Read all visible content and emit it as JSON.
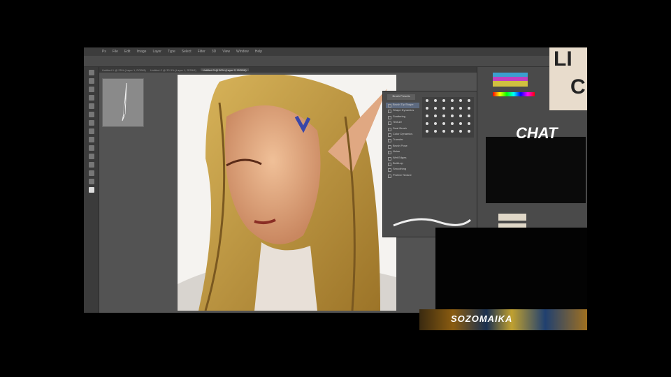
{
  "menu": [
    "Ps",
    "File",
    "Edit",
    "Image",
    "Layer",
    "Type",
    "Select",
    "Filter",
    "3D",
    "View",
    "Window",
    "Help"
  ],
  "document_tabs": [
    "Untitled-1 @ 25% (Layer 1, RGB/8)",
    "Untitled-2 @ 33.3% (Layer 1, RGB/8)",
    "Untitled-3 @ 50% (Layer 2, RGB/8)"
  ],
  "brush_panel": {
    "presets_button": "Brush Presets",
    "items": [
      "Brush Tip Shape",
      "Shape Dynamics",
      "Scattering",
      "Texture",
      "Dual Brush",
      "Color Dynamics",
      "Transfer",
      "Brush Pose",
      "Noise",
      "Wet Edges",
      "Build-up",
      "Smoothing",
      "Protect Texture"
    ]
  },
  "overlay": {
    "chat_label": "CHAT",
    "logo": "SOZOMAIKA",
    "deco_letters": [
      "LI",
      "C"
    ]
  },
  "colors": {
    "ps_bg": "#535353",
    "panel": "#4b4b4b",
    "hair": "#c9a046",
    "skin": "#e0a882"
  }
}
